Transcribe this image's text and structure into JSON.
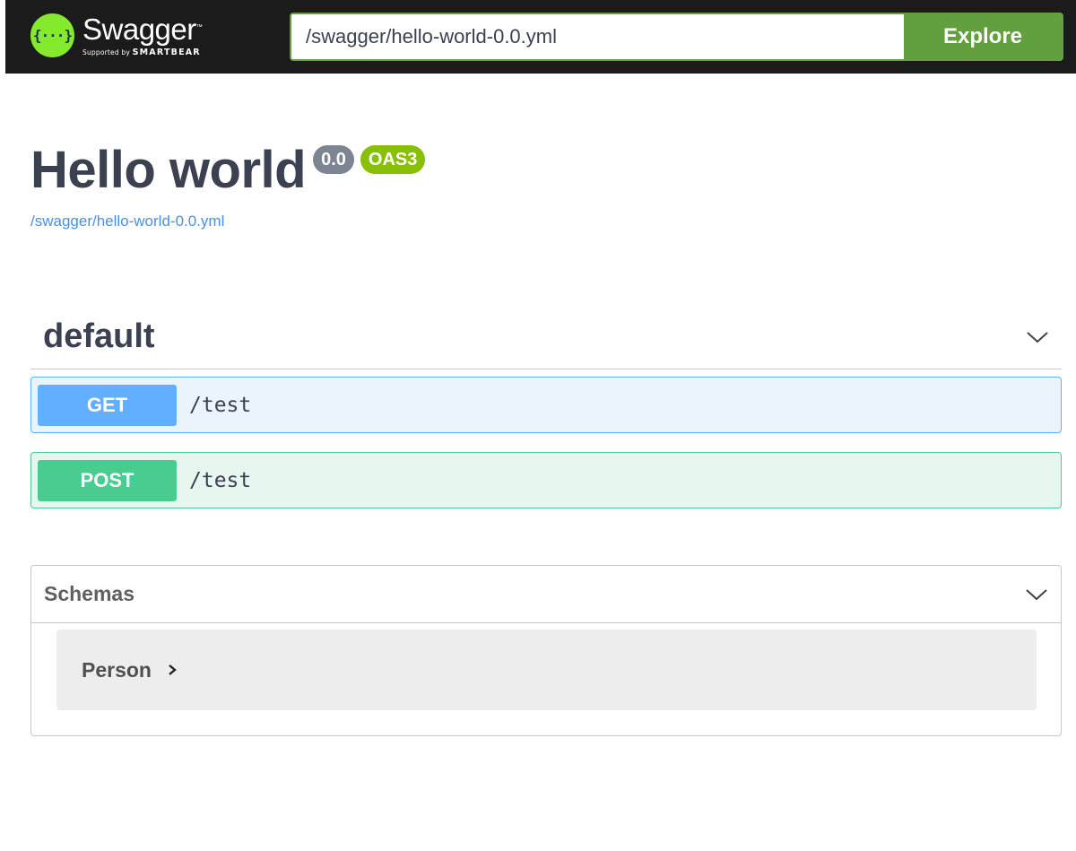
{
  "topbar": {
    "logo_symbol": "{···}",
    "logo_title": "Swagger",
    "logo_trademark": "™",
    "logo_supported_by": "Supported by",
    "logo_company": "SMARTBEAR",
    "url_value": "/swagger/hello-world-0.0.yml",
    "explore_label": "Explore",
    "accent_color": "#62a03f",
    "logo_color": "#85ea2d"
  },
  "info": {
    "title": "Hello world",
    "version_badge": "0.0",
    "oas_badge": "OAS3",
    "spec_link": "/swagger/hello-world-0.0.yml"
  },
  "tag": {
    "name": "default",
    "chevron_icon": "chevron-down-icon",
    "operations": [
      {
        "method": "GET",
        "path": "/test",
        "color": "#61affe"
      },
      {
        "method": "POST",
        "path": "/test",
        "color": "#49cc90"
      }
    ]
  },
  "schemas": {
    "title": "Schemas",
    "chevron_icon": "chevron-down-icon",
    "models": [
      {
        "name": "Person",
        "arrow_icon": "chevron-right-icon"
      }
    ]
  }
}
